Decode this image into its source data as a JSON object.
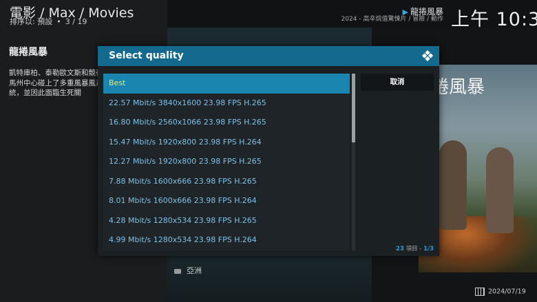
{
  "header": {
    "breadcrumb": "電影 / Max / Movies",
    "sort_label": "排序以: 預設",
    "position": "3 / 19",
    "now_playing_title": "龍捲風暴",
    "now_playing_genre": "2024 - 高辛烷值驚悚片 / 冒險 / 動作",
    "clock": "上午 10:3"
  },
  "info": {
    "title": "龍捲風暴",
    "plot": "凱特庫柏、泰勒歐文斯和競荷馬州中心碰上了多重風暴風系統，並因此面臨生死關",
    "poster_title": "捲風暴",
    "folder": "亞洲",
    "date": "2024/07/19"
  },
  "dialog": {
    "title": "Select quality",
    "cancel_label": "取消",
    "items": [
      "Best",
      "22.57 Mbit/s 3840x1600 23.98 FPS H.265",
      "16.80 Mbit/s 2560x1066 23.98 FPS H.265",
      "15.47 Mbit/s 1920x800 23.98 FPS H.264",
      "12.27 Mbit/s 1920x800 23.98 FPS H.265",
      "7.88 Mbit/s 1600x666 23.98 FPS H.265",
      "8.01 Mbit/s 1600x666 23.98 FPS H.264",
      "4.28 Mbit/s 1280x534 23.98 FPS H.265",
      "4.99 Mbit/s 1280x534 23.98 FPS H.264"
    ],
    "selected_index": 0,
    "count_number": "23",
    "count_label": "項目 -",
    "page": "1/3"
  },
  "colors": {
    "header_blue": "#136a8e",
    "selected_bg": "#1a86b0",
    "selected_text": "#f0e46a",
    "item_text": "#7fc1e6",
    "accent": "#2f9bd3"
  }
}
